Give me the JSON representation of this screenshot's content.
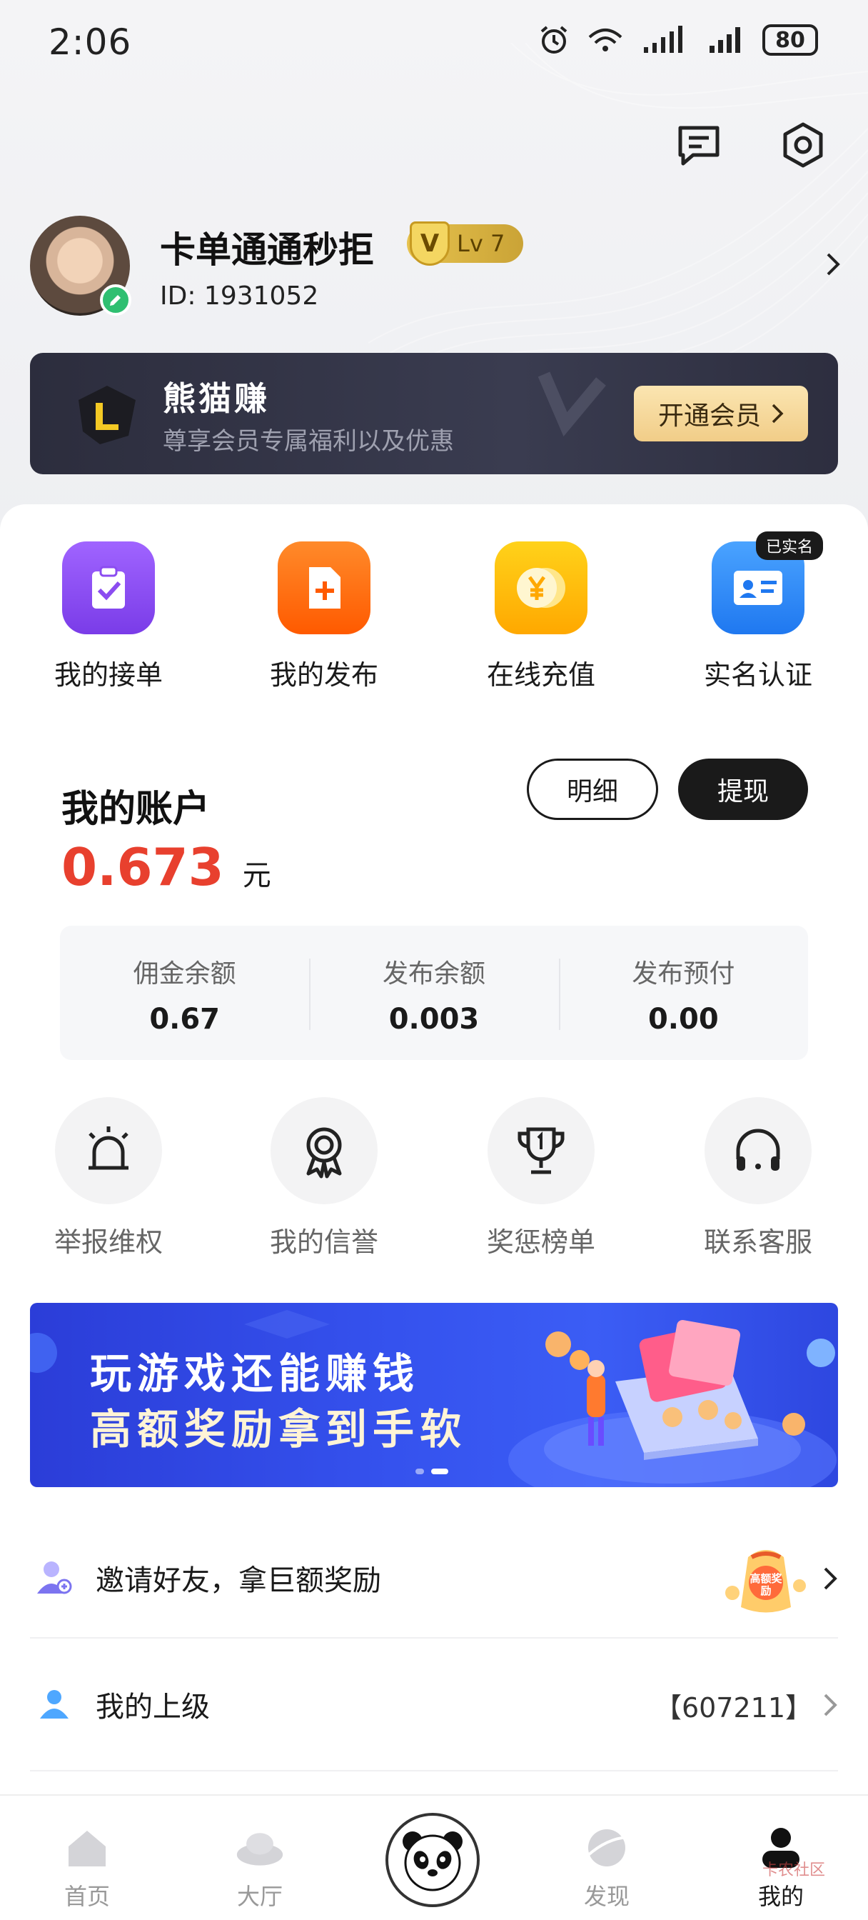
{
  "status_bar": {
    "time": "2:06",
    "battery": "80"
  },
  "profile": {
    "nickname": "卡单通通秒拒",
    "level": "Lv 7",
    "level_shield": "V",
    "id_text": "ID:  1931052"
  },
  "vip": {
    "title": "熊猫赚",
    "subtitle": "尊享会员专属福利以及优惠",
    "button": "开通会员"
  },
  "quick_actions": [
    {
      "label": "我的接单",
      "icon": "clipboard-check-icon",
      "color": "#8b4cf0"
    },
    {
      "label": "我的发布",
      "icon": "document-plus-icon",
      "color": "#ff6a12"
    },
    {
      "label": "在线充值",
      "icon": "yen-coin-icon",
      "color": "#ffb800"
    },
    {
      "label": "实名认证",
      "icon": "id-card-icon",
      "color": "#2f86f6",
      "tag": "已实名"
    }
  ],
  "account": {
    "title": "我的账户",
    "detail_button": "明细",
    "withdraw_button": "提现",
    "balance": "0.673",
    "unit": "元",
    "items": [
      {
        "label": "佣金余额",
        "value": "0.67"
      },
      {
        "label": "发布余额",
        "value": "0.003"
      },
      {
        "label": "发布预付",
        "value": "0.00"
      }
    ]
  },
  "tools": [
    {
      "label": "举报维权",
      "icon": "alarm-light-icon"
    },
    {
      "label": "我的信誉",
      "icon": "award-medal-icon"
    },
    {
      "label": "奖惩榜单",
      "icon": "trophy-icon"
    },
    {
      "label": "联系客服",
      "icon": "headphones-icon"
    }
  ],
  "promo": {
    "line1": "玩游戏还能赚钱",
    "line2": "高额奖励拿到手软"
  },
  "list": {
    "invite_label": "邀请好友，拿巨额奖励",
    "invite_badge": "高额奖励",
    "superior_label": "我的上级",
    "superior_value": "【607211】"
  },
  "bottom_nav": [
    {
      "label": "首页"
    },
    {
      "label": "大厅"
    },
    {
      "label": "发现"
    },
    {
      "label": "我的"
    }
  ],
  "watermark": "卡农社区"
}
